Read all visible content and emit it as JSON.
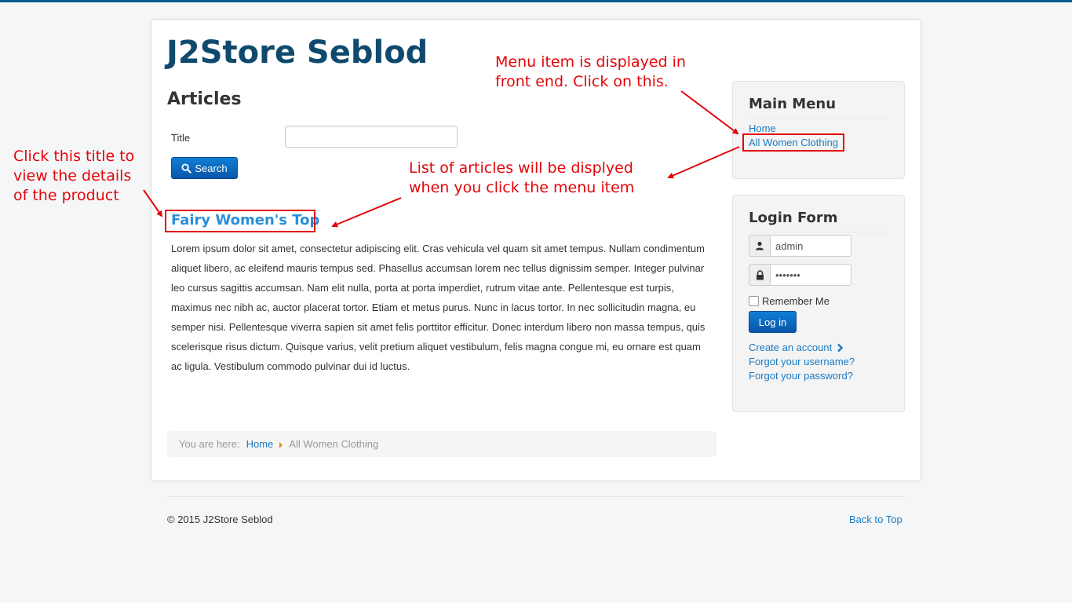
{
  "site": {
    "brand": "J2Store Seblod",
    "accent_color": "#2a8fd8",
    "brand_color": "#0f4a6e"
  },
  "main": {
    "page_heading": "Articles",
    "search": {
      "label": "Title",
      "value": "",
      "button_label": "Search",
      "button_icon": "search-icon"
    },
    "article": {
      "title": "Fairy Women's Top",
      "body": "Lorem ipsum dolor sit amet, consectetur adipiscing elit. Cras vehicula vel quam sit amet tempus. Nullam condimentum aliquet libero, ac eleifend mauris tempus sed. Phasellus accumsan lorem nec tellus dignissim semper. Integer pulvinar leo cursus sagittis accumsan. Nam elit nulla, porta at porta imperdiet, rutrum vitae ante. Pellentesque est turpis, maximus nec nibh ac, auctor placerat tortor. Etiam et metus purus. Nunc in lacus tortor. In nec sollicitudin magna, eu semper nisi. Pellentesque viverra sapien sit amet felis porttitor efficitur. Donec interdum libero non massa tempus, quis scelerisque risus dictum. Quisque varius, velit pretium aliquet vestibulum, felis magna congue mi, eu ornare est quam ac ligula. Vestibulum commodo pulvinar dui id luctus."
    },
    "breadcrumb": {
      "prefix": "You are here:",
      "home": "Home",
      "current": "All Women Clothing"
    }
  },
  "sidebar": {
    "main_menu": {
      "title": "Main Menu",
      "items": [
        {
          "label": "Home"
        },
        {
          "label": "All Women Clothing"
        }
      ]
    },
    "login": {
      "title": "Login Form",
      "username_value": "admin",
      "password_value": "•••••••",
      "user_icon": "user-icon",
      "lock_icon": "lock-icon",
      "remember_label": "Remember Me",
      "remember_checked": false,
      "login_button": "Log in",
      "create_account": "Create an account",
      "forgot_username": "Forgot your username?",
      "forgot_password": "Forgot your password?"
    }
  },
  "footer": {
    "copyright": "© 2015 J2Store Seblod",
    "back_to_top": "Back to Top"
  },
  "annotations": {
    "menu_note": [
      "Menu item is displayed in",
      "front end. Click on this."
    ],
    "list_note": [
      "List of articles will be displyed",
      "when you click the menu item"
    ],
    "title_note": [
      "Click this title to",
      "view the details",
      "of the product"
    ],
    "color": "#e3050a"
  }
}
